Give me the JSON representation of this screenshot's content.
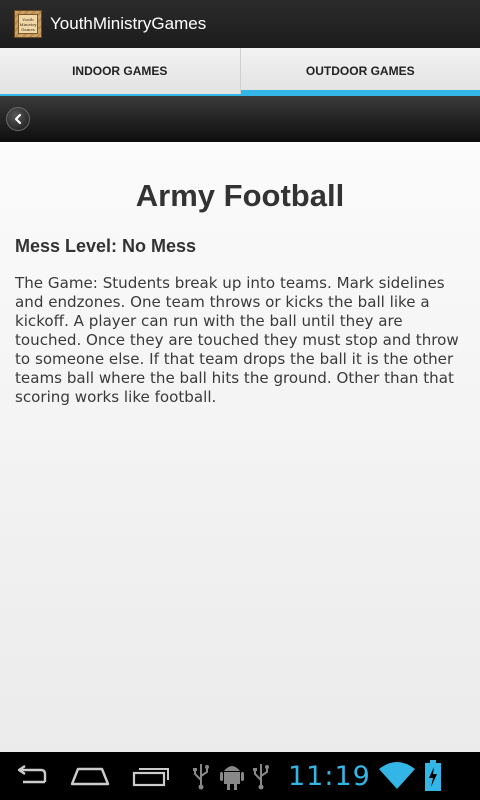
{
  "app": {
    "title": "YouthMinistryGames",
    "icon": "app-logo-icon",
    "icon_text": "Youth Ministry Games"
  },
  "tabs": [
    {
      "label": "INDOOR GAMES",
      "selected": false
    },
    {
      "label": "OUTDOOR GAMES",
      "selected": true
    }
  ],
  "toolbar": {
    "back_icon": "back-arrow-icon"
  },
  "game": {
    "title": "Army Football",
    "mess_level": "Mess Level: No Mess",
    "description": "The Game: Students break up into teams. Mark sidelines and endzones. One team throws or kicks the ball like a kickoff. A player can run with the ball until they are touched. Once they are touched they must stop and throw to someone else. If that team drops the ball it is the other teams ball where the ball hits the ground. Other than that scoring works like football."
  },
  "system_bar": {
    "time": "11:19",
    "nav_icons": [
      "back-icon",
      "home-icon",
      "recent-apps-icon"
    ],
    "status_icons": [
      "usb-icon",
      "android-debug-icon",
      "usb-icon",
      "wifi-icon",
      "battery-charging-icon"
    ]
  },
  "colors": {
    "accent": "#33b5e5",
    "action_bar": "#222222",
    "content_bg": "#f5f5f5"
  }
}
